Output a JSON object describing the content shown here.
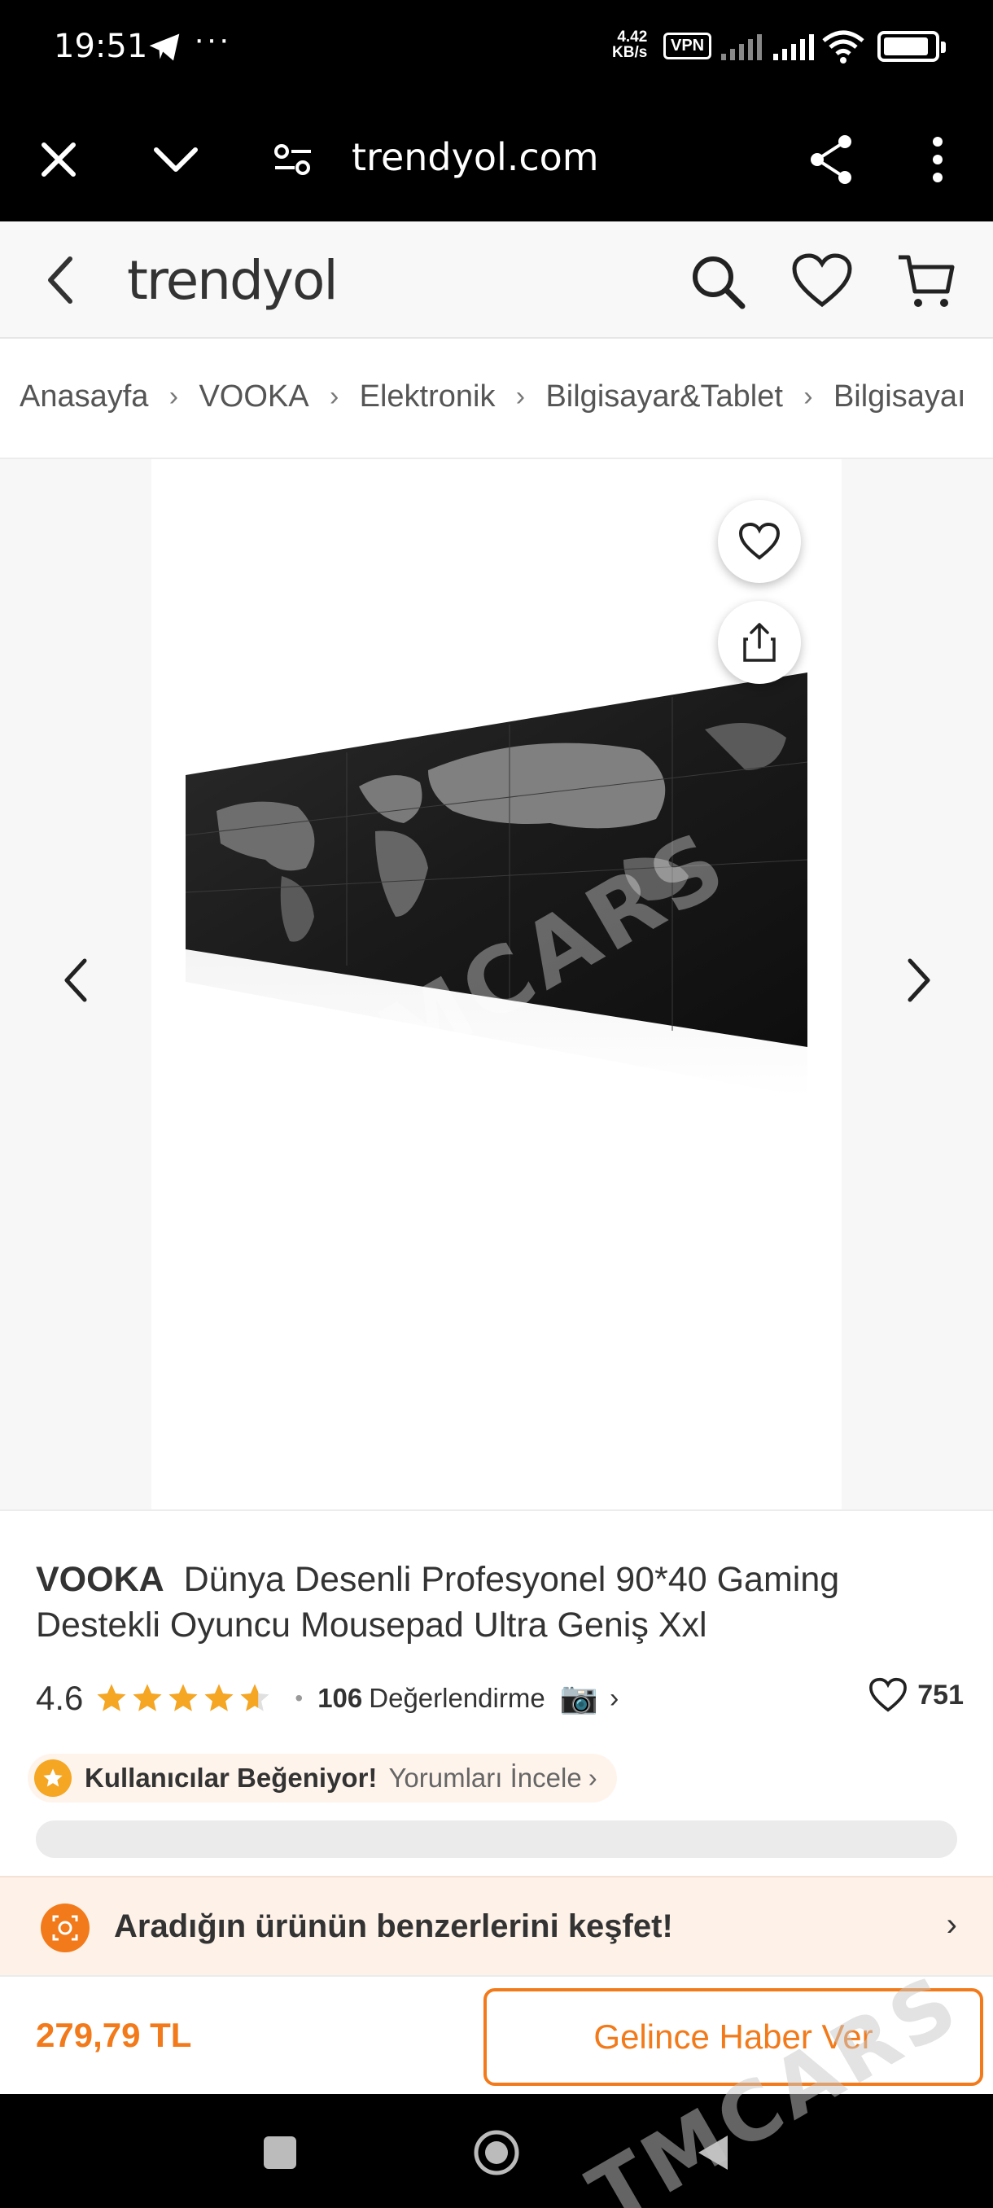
{
  "status_bar": {
    "time": "19:51",
    "more": "···",
    "net_speed_value": "4.42",
    "net_speed_unit": "KB/s",
    "vpn": "VPN"
  },
  "browser": {
    "url": "trendyol.com"
  },
  "header": {
    "logo": "trendyol"
  },
  "breadcrumb": {
    "items": [
      "Anasayfa",
      "VOOKA",
      "Elektronik",
      "Bilgisayar&Tablet",
      "Bilgisayaı"
    ]
  },
  "gallery": {
    "watermark": "TMCARS"
  },
  "product": {
    "brand": "VOOKA",
    "title": "Dünya Desenli Profesyonel 90*40 Gaming Destekli Oyuncu Mousepad Ultra Geniş Xxl",
    "rating": "4.6",
    "rating_value": 4.6,
    "rating_max": 5,
    "review_count": "106",
    "review_label": "Değerlendirme",
    "favorites": "751"
  },
  "badge": {
    "label": "Kullanıcılar Beğeniyor!",
    "link": "Yorumları İncele"
  },
  "discover": {
    "text": "Aradığın ürünün benzerlerini keşfet!"
  },
  "buy": {
    "price": "279,79 TL",
    "notify_label": "Gelince Haber Ver"
  },
  "colors": {
    "accent": "#f27a1a",
    "star": "#f5a623",
    "banner_bg": "#fdf1e8"
  }
}
